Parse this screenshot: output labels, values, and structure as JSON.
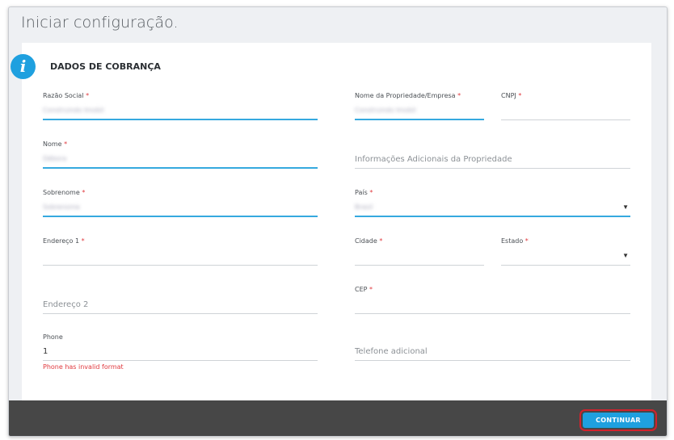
{
  "page": {
    "title": "Iniciar configuração.",
    "section_title": "DADOS DE COBRANÇA",
    "info_icon_glyph": "i"
  },
  "form": {
    "razao_social": {
      "label": "Razão Social",
      "required": "*",
      "value": "Construindo Imobil"
    },
    "nome_propriedade": {
      "label": "Nome da Propriedade/Empresa",
      "required": "*",
      "value": "Construindo Imobil"
    },
    "cnpj": {
      "label": "CNPJ",
      "required": "*"
    },
    "nome": {
      "label": "Nome",
      "required": "*",
      "value": "Débora"
    },
    "info_adicionais": {
      "placeholder": "Informações Adicionais da Propriedade"
    },
    "sobrenome": {
      "label": "Sobrenome",
      "required": "*",
      "value": "Sobrenome"
    },
    "pais": {
      "label": "País",
      "required": "*",
      "value": "Brasil"
    },
    "endereco1": {
      "label": "Endereço 1",
      "required": "*"
    },
    "cidade": {
      "label": "Cidade",
      "required": "*"
    },
    "estado": {
      "label": "Estado",
      "required": "*"
    },
    "endereco2": {
      "placeholder": "Endereço 2"
    },
    "cep": {
      "label": "CEP",
      "required": "*"
    },
    "phone": {
      "label": "Phone",
      "value": "1",
      "error": "Phone has invalid format"
    },
    "telefone_adicional": {
      "placeholder": "Telefone adicional"
    }
  },
  "footer": {
    "continue_label": "CONTINUAR"
  },
  "colors": {
    "accent": "#1fa0df",
    "required": "#e0393e",
    "footer": "#474747",
    "highlight": "#d3212c"
  }
}
